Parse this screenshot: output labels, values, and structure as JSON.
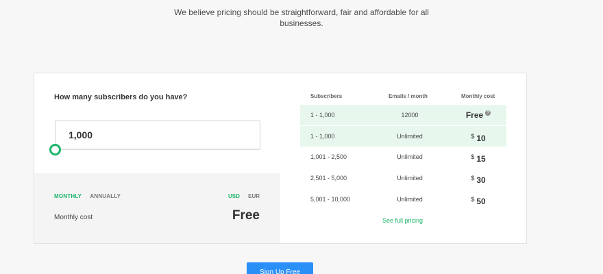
{
  "tagline": {
    "line1": "We believe pricing should be straightforward, fair and affordable for all",
    "line2": "businesses."
  },
  "calculator": {
    "question": "How many subscribers do you have?",
    "subscribers_value": "1,000",
    "slider_fraction": 0.0,
    "billing": {
      "monthly": "MONTHLY",
      "annually": "ANNUALLY",
      "selected": "monthly"
    },
    "currency": {
      "usd": "USD",
      "eur": "EUR",
      "selected": "usd"
    },
    "cost_label": "Monthly cost",
    "cost_value": "Free"
  },
  "table": {
    "headers": {
      "subscribers": "Subscribers",
      "emails": "Emails / month",
      "cost": "Monthly cost"
    },
    "rows": [
      {
        "subscribers": "1 - 1,000",
        "emails": "12000",
        "currency": "",
        "price": "Free",
        "help": "?"
      },
      {
        "subscribers": "1 - 1,000",
        "emails": "Unlimited",
        "currency": "$",
        "price": "10"
      },
      {
        "subscribers": "1,001 - 2,500",
        "emails": "Unlimited",
        "currency": "$",
        "price": "15"
      },
      {
        "subscribers": "2,501 - 5,000",
        "emails": "Unlimited",
        "currency": "$",
        "price": "30"
      },
      {
        "subscribers": "5,001 - 10,000",
        "emails": "Unlimited",
        "currency": "$",
        "price": "50"
      }
    ],
    "full_pricing_link": "See full pricing"
  },
  "signup_button": "Sign Up Free",
  "colors": {
    "accent_green": "#1db56b",
    "highlight": "#e8f7ee",
    "button_blue": "#2a8ff7"
  }
}
